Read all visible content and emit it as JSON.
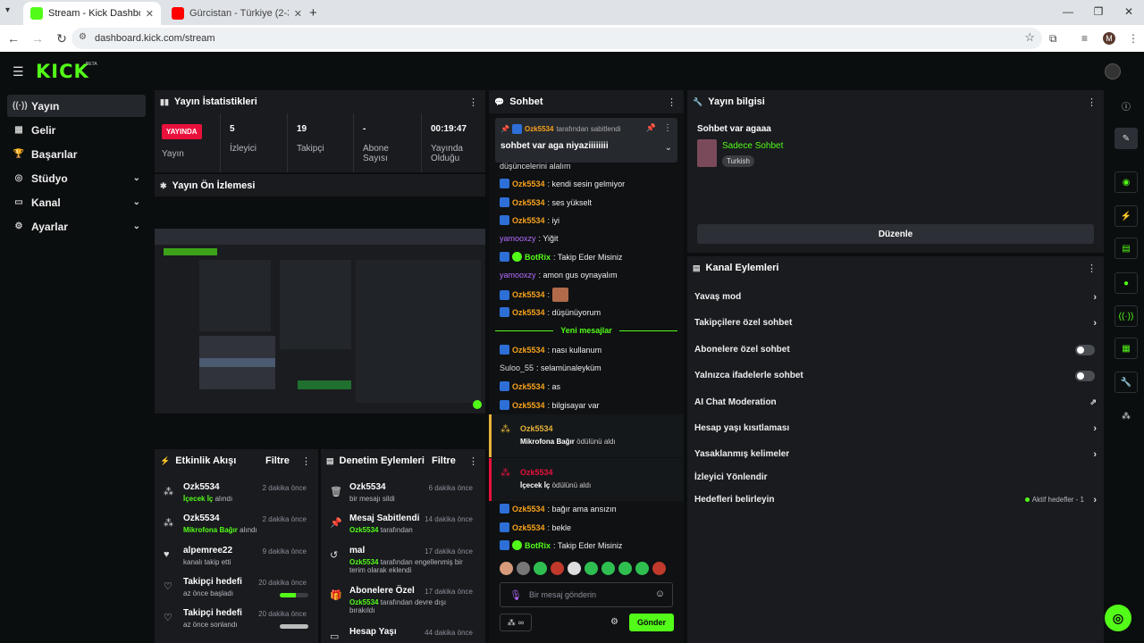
{
  "browser": {
    "tabs": [
      {
        "title": "Stream - Kick Dashboard",
        "close": "✕"
      },
      {
        "title": "Gürcistan - Türkiye (2-3) Maç Ö",
        "close": "✕"
      }
    ],
    "new_tab": "+",
    "url": "dashboard.kick.com/stream",
    "profile_initial": "M",
    "window_controls": [
      "—",
      "❐",
      "✕"
    ]
  },
  "brand": {
    "logo": "KICK",
    "beta": "BETA"
  },
  "sidebar": {
    "items": [
      {
        "label": "Yayın",
        "icon": "broadcast-icon"
      },
      {
        "label": "Gelir",
        "icon": "revenue-icon"
      },
      {
        "label": "Başarılar",
        "icon": "trophy-icon"
      },
      {
        "label": "Stüdyo",
        "icon": "studio-icon"
      },
      {
        "label": "Kanal",
        "icon": "channel-icon"
      },
      {
        "label": "Ayarlar",
        "icon": "settings-icon"
      }
    ]
  },
  "stats": {
    "title": "Yayın İstatistikleri",
    "live_badge": "YAYINDA",
    "live_label": "Yayın",
    "viewers": {
      "value": "5",
      "label": "İzleyici"
    },
    "followers": {
      "value": "19",
      "label": "Takipçi"
    },
    "subs": {
      "value": "-",
      "label": "Abone Sayısı"
    },
    "uptime": {
      "value": "00:19:47",
      "label": "Yayında Olduğu"
    }
  },
  "preview": {
    "title": "Yayın Ön İzlemesi"
  },
  "activity": {
    "title": "Etkinlik Akışı",
    "filter": "Filtre",
    "items": [
      {
        "name": "Ozk5534",
        "highlight": "İçecek İç",
        "rest": " alındı",
        "time": "2 dakika önce"
      },
      {
        "name": "Ozk5534",
        "highlight": "Mikrofona Bağır",
        "rest": " alındı",
        "time": "2 dakika önce"
      },
      {
        "name": "alpemree22",
        "highlight": "",
        "rest": "kanalı takip etti",
        "time": "9 dakika önce"
      },
      {
        "name": "Takipçi hedefi",
        "highlight": "",
        "rest": "az önce başladı",
        "time": "20 dakika önce",
        "progress": 0.55
      },
      {
        "name": "Takipçi hedefi",
        "highlight": "",
        "rest": "az önce sonlandı",
        "time": "20 dakika önce",
        "progress": 1.0
      }
    ]
  },
  "moderation": {
    "title": "Denetim Eylemleri",
    "filter": "Filtre",
    "items": [
      {
        "name": "Ozk5534",
        "line1": "bir mesajı sildi",
        "line2": "",
        "time": "6 dakika önce"
      },
      {
        "name": "Mesaj Sabitlendi",
        "line1": "Ozk5534",
        "line1b": " tarafından",
        "line2": "",
        "time": "14 dakika önce"
      },
      {
        "name": "mal",
        "line1": "Ozk5534",
        "line1b": " tarafından engellenmiş bir",
        "line2": "terim olarak eklendi",
        "time": "17 dakika önce"
      },
      {
        "name": "Abonelere Özel",
        "line1": "Ozk5534",
        "line1b": " tarafından devre dışı",
        "line2": "bırakıldı",
        "time": "17 dakika önce"
      },
      {
        "name": "Hesap Yaşı",
        "line1": "",
        "line2": "",
        "time": "44 dakika önce"
      }
    ]
  },
  "chat": {
    "title": "Sohbet",
    "pinned": {
      "user": "Ozk5534",
      "by": "tarafından sabitlendi",
      "text": "sohbet var aga niyaziiiiiiii"
    },
    "messages_before": [
      {
        "user": "",
        "text": "düşüncelerini alalım",
        "color": "wh",
        "badge": false
      },
      {
        "user": "Ozk5534",
        "text": ": kendi sesin gelmiyor",
        "color": "or",
        "badge": true
      },
      {
        "user": "Ozk5534",
        "text": ": ses yükselt",
        "color": "or",
        "badge": true
      },
      {
        "user": "Ozk5534",
        "text": ": iyi",
        "color": "or",
        "badge": true
      },
      {
        "user": "yamooxzy",
        "text": ": Yiğit",
        "color": "pu",
        "badge": false
      },
      {
        "user": "BotRix",
        "text": ": Takip Eder Misiniz",
        "color": "gr",
        "badge": true
      },
      {
        "user": "yamooxzy",
        "text": ": amon gus oynayalım",
        "color": "pu",
        "badge": false
      },
      {
        "user": "Ozk5534",
        "text": ":",
        "color": "or",
        "badge": true
      },
      {
        "user": "Ozk5534",
        "text": ": düşünüyorum",
        "color": "or",
        "badge": true
      }
    ],
    "new_messages": "Yeni mesajlar",
    "messages_after": [
      {
        "user": "Ozk5534",
        "text": ": nası kullanum",
        "color": "or",
        "badge": true
      },
      {
        "user": "Suloo_55",
        "text": ": selamünaleyküm",
        "color": "wh",
        "badge": false
      },
      {
        "user": "Ozk5534",
        "text": ": as",
        "color": "or",
        "badge": true
      },
      {
        "user": "Ozk5534",
        "text": ": bilgisayar var",
        "color": "or",
        "badge": true
      }
    ],
    "rewards": [
      {
        "user": "Ozk5534",
        "reward": "Mikrofona Bağır",
        "rest": " ödülünü aldı"
      },
      {
        "user": "Ozk5534",
        "reward": "İçecek İç",
        "rest": " ödülünü aldı"
      }
    ],
    "messages_end": [
      {
        "user": "Ozk5534",
        "text": ": bağır ama ansızın",
        "color": "or",
        "badge": true
      },
      {
        "user": "Ozk5534",
        "text": ": bekle",
        "color": "or",
        "badge": true
      },
      {
        "user": "BotRix",
        "text": ": Takip Eder Misiniz",
        "color": "gr",
        "badge": true
      }
    ],
    "input_placeholder": "Bir mesaj gönderin",
    "send": "Gönder",
    "points": "∞"
  },
  "stream_info": {
    "title": "Yayın bilgisi",
    "stream_title": "Sohbet var agaaa",
    "category": "Sadece Sohbet",
    "language": "Turkish",
    "edit": "Düzenle"
  },
  "channel_actions": {
    "title": "Kanal Eylemleri",
    "items": [
      {
        "label": "Yavaş mod",
        "control": "chevron"
      },
      {
        "label": "Takipçilere özel sohbet",
        "control": "chevron"
      },
      {
        "label": "Abonelere özel sohbet",
        "control": "toggle"
      },
      {
        "label": "Yalnızca ifadelerle sohbet",
        "control": "toggle"
      },
      {
        "label": "AI Chat Moderation",
        "control": "external"
      },
      {
        "label": "Hesap yaşı kısıtlaması",
        "control": "chevron"
      },
      {
        "label": "Yasaklanmış kelimeler",
        "control": "chevron"
      },
      {
        "label": "İzleyici Yönlendir",
        "control": "none"
      },
      {
        "label": "Hedefleri belirleyin",
        "control": "chevron",
        "extra": "Aktif hedefler - 1"
      }
    ]
  },
  "colors": {
    "accent": "#53fc18",
    "live": "#e9113c",
    "username": "#f7a21b",
    "purple": "#b76cff"
  }
}
